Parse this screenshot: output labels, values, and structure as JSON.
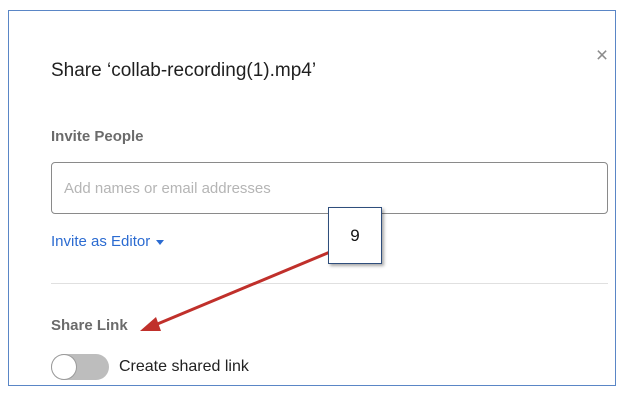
{
  "dialog": {
    "title": "Share ‘collab-recording(1).mp4’",
    "close_glyph": "×"
  },
  "invite": {
    "label": "Invite People",
    "placeholder": "Add names or email addresses",
    "value": "",
    "permission_label": "Invite as Editor"
  },
  "share_link": {
    "label": "Share Link",
    "toggle_label": "Create shared link",
    "toggle_on": false
  },
  "annotation": {
    "callout_number": "9",
    "arrow_color": "#c0302b"
  },
  "colors": {
    "link": "#2b6bd1",
    "border": "#5a86c6",
    "toggle_off": "#bdbdbd"
  }
}
